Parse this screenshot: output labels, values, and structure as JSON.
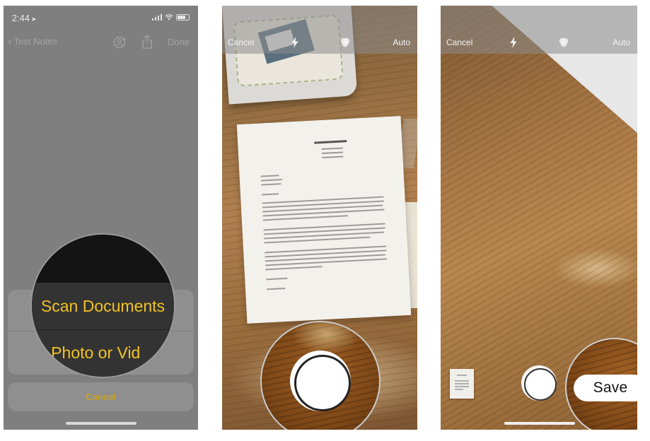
{
  "notes": {
    "status_time": "2:44",
    "nav_back": "Test Notes",
    "nav_done": "Done",
    "sheet_cancel": "Cancel",
    "magnify_scan": "Scan Documents",
    "magnify_photo": "e Photo or Vid"
  },
  "camera": {
    "cancel": "Cancel",
    "auto": "Auto"
  },
  "review": {
    "cancel": "Cancel",
    "auto": "Auto",
    "save": "Save"
  },
  "icons": {
    "back": "chevron-left-icon",
    "add_person": "add-person-icon",
    "share": "share-icon",
    "flash": "flash-icon",
    "filter": "filter-icon"
  },
  "colors": {
    "ios_yellow": "#f2c224",
    "sheet_cancel": "#c9a224"
  }
}
